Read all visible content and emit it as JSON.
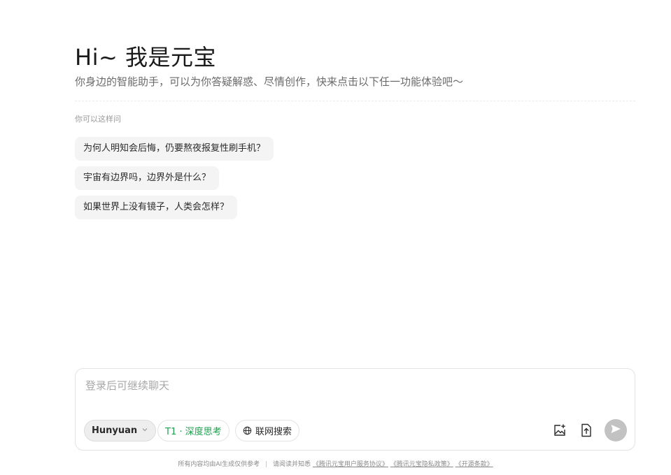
{
  "hero": {
    "title": "Hi~ 我是元宝",
    "subtitle": "你身边的智能助手，可以为你答疑解惑、尽情创作，快来点击以下任一功能体验吧～"
  },
  "suggestions": {
    "label": "你可以这样问",
    "items": [
      "为何人明知会后悔，仍要熬夜报复性刷手机？",
      "宇宙有边界吗，边界外是什么？",
      "如果世界上没有镜子，人类会怎样？"
    ]
  },
  "composer": {
    "placeholder": "登录后可继续聊天",
    "value": "",
    "model_label": "Hunyuan",
    "deep_think_label": "T1 · 深度思考",
    "web_search_label": "联网搜索",
    "accent_color": "#1ba34e"
  },
  "icons": {
    "model_chevron": "chevron-down-icon",
    "web_search": "globe-icon",
    "image": "image-add-icon",
    "upload": "file-upload-icon",
    "send": "send-icon"
  },
  "footer": {
    "disclaimer": "所有内容均由AI生成仅供参考",
    "separator": "|",
    "prompt": "请阅读并知悉",
    "links": [
      "《腾讯元宝用户服务协议》",
      "《腾讯元宝隐私政策》",
      "《开源条款》"
    ]
  }
}
